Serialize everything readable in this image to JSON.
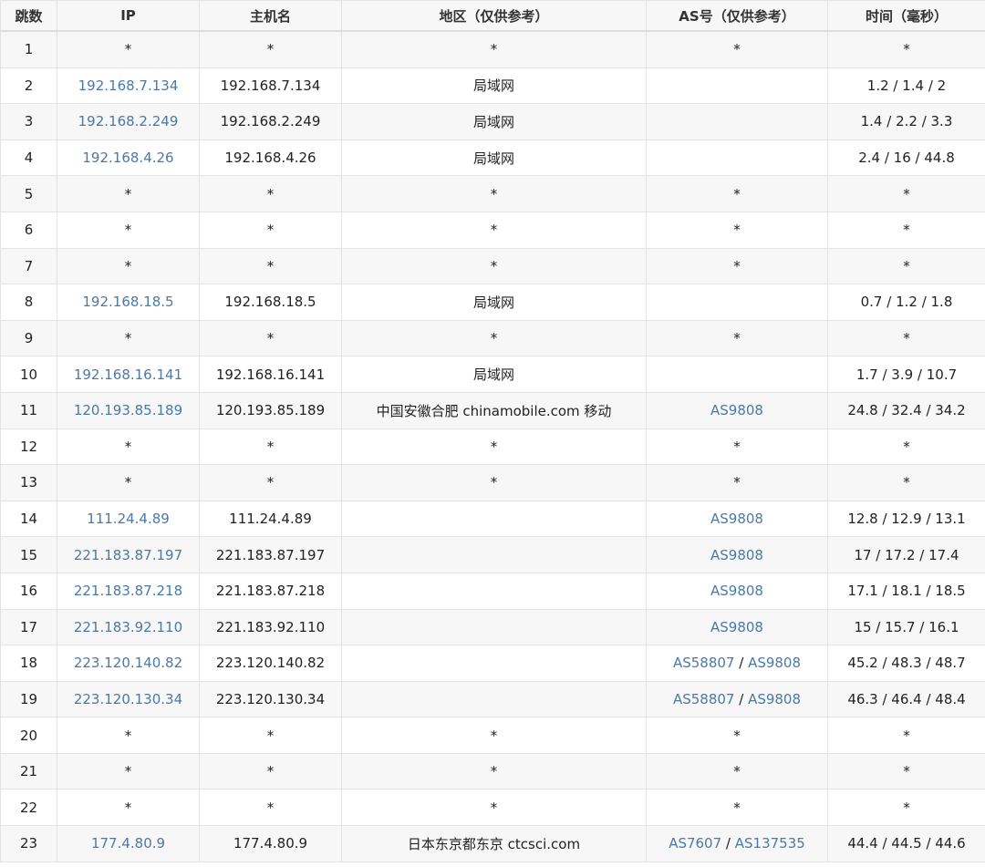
{
  "colors": {
    "link": "#4a79a8",
    "text": "#222222",
    "row_alt": "#f7f7f7",
    "border": "#e3e3e3"
  },
  "table": {
    "columns": [
      "跳数",
      "IP",
      "主机名",
      "地区（仅供参考）",
      "AS号（仅供参考）",
      "时间（毫秒）"
    ],
    "rows": [
      {
        "hop": "1",
        "ip": "*",
        "ip_link": false,
        "host": "*",
        "region": "*",
        "as": [
          "*"
        ],
        "as_link": false,
        "time": "*"
      },
      {
        "hop": "2",
        "ip": "192.168.7.134",
        "ip_link": true,
        "host": "192.168.7.134",
        "region": "局域网",
        "as": [],
        "as_link": false,
        "time": "1.2 / 1.4 / 2"
      },
      {
        "hop": "3",
        "ip": "192.168.2.249",
        "ip_link": true,
        "host": "192.168.2.249",
        "region": "局域网",
        "as": [],
        "as_link": false,
        "time": "1.4 / 2.2 / 3.3"
      },
      {
        "hop": "4",
        "ip": "192.168.4.26",
        "ip_link": true,
        "host": "192.168.4.26",
        "region": "局域网",
        "as": [],
        "as_link": false,
        "time": "2.4 / 16 / 44.8"
      },
      {
        "hop": "5",
        "ip": "*",
        "ip_link": false,
        "host": "*",
        "region": "*",
        "as": [
          "*"
        ],
        "as_link": false,
        "time": "*"
      },
      {
        "hop": "6",
        "ip": "*",
        "ip_link": false,
        "host": "*",
        "region": "*",
        "as": [
          "*"
        ],
        "as_link": false,
        "time": "*"
      },
      {
        "hop": "7",
        "ip": "*",
        "ip_link": false,
        "host": "*",
        "region": "*",
        "as": [
          "*"
        ],
        "as_link": false,
        "time": "*"
      },
      {
        "hop": "8",
        "ip": "192.168.18.5",
        "ip_link": true,
        "host": "192.168.18.5",
        "region": "局域网",
        "as": [],
        "as_link": false,
        "time": "0.7 / 1.2 / 1.8"
      },
      {
        "hop": "9",
        "ip": "*",
        "ip_link": false,
        "host": "*",
        "region": "*",
        "as": [
          "*"
        ],
        "as_link": false,
        "time": "*"
      },
      {
        "hop": "10",
        "ip": "192.168.16.141",
        "ip_link": true,
        "host": "192.168.16.141",
        "region": "局域网",
        "as": [],
        "as_link": false,
        "time": "1.7 / 3.9 / 10.7"
      },
      {
        "hop": "11",
        "ip": "120.193.85.189",
        "ip_link": true,
        "host": "120.193.85.189",
        "region": "中国安徽合肥 chinamobile.com 移动",
        "as": [
          "AS9808"
        ],
        "as_link": true,
        "time": "24.8 / 32.4 / 34.2"
      },
      {
        "hop": "12",
        "ip": "*",
        "ip_link": false,
        "host": "*",
        "region": "*",
        "as": [
          "*"
        ],
        "as_link": false,
        "time": "*"
      },
      {
        "hop": "13",
        "ip": "*",
        "ip_link": false,
        "host": "*",
        "region": "*",
        "as": [
          "*"
        ],
        "as_link": false,
        "time": "*"
      },
      {
        "hop": "14",
        "ip": "111.24.4.89",
        "ip_link": true,
        "host": "111.24.4.89",
        "region": "",
        "as": [
          "AS9808"
        ],
        "as_link": true,
        "time": "12.8 / 12.9 / 13.1"
      },
      {
        "hop": "15",
        "ip": "221.183.87.197",
        "ip_link": true,
        "host": "221.183.87.197",
        "region": "",
        "as": [
          "AS9808"
        ],
        "as_link": true,
        "time": "17 / 17.2 / 17.4"
      },
      {
        "hop": "16",
        "ip": "221.183.87.218",
        "ip_link": true,
        "host": "221.183.87.218",
        "region": "",
        "as": [
          "AS9808"
        ],
        "as_link": true,
        "time": "17.1 / 18.1 / 18.5"
      },
      {
        "hop": "17",
        "ip": "221.183.92.110",
        "ip_link": true,
        "host": "221.183.92.110",
        "region": "",
        "as": [
          "AS9808"
        ],
        "as_link": true,
        "time": "15 / 15.7 / 16.1"
      },
      {
        "hop": "18",
        "ip": "223.120.140.82",
        "ip_link": true,
        "host": "223.120.140.82",
        "region": "",
        "as": [
          "AS58807",
          "AS9808"
        ],
        "as_link": true,
        "time": "45.2 / 48.3 / 48.7"
      },
      {
        "hop": "19",
        "ip": "223.120.130.34",
        "ip_link": true,
        "host": "223.120.130.34",
        "region": "",
        "as": [
          "AS58807",
          "AS9808"
        ],
        "as_link": true,
        "time": "46.3 / 46.4 / 48.4"
      },
      {
        "hop": "20",
        "ip": "*",
        "ip_link": false,
        "host": "*",
        "region": "*",
        "as": [
          "*"
        ],
        "as_link": false,
        "time": "*"
      },
      {
        "hop": "21",
        "ip": "*",
        "ip_link": false,
        "host": "*",
        "region": "*",
        "as": [
          "*"
        ],
        "as_link": false,
        "time": "*"
      },
      {
        "hop": "22",
        "ip": "*",
        "ip_link": false,
        "host": "*",
        "region": "*",
        "as": [
          "*"
        ],
        "as_link": false,
        "time": "*"
      },
      {
        "hop": "23",
        "ip": "177.4.80.9",
        "ip_link": true,
        "host": "177.4.80.9",
        "region": "日本东京都东京 ctcsci.com",
        "as": [
          "AS7607",
          "AS137535"
        ],
        "as_link": true,
        "time": "44.4 / 44.5 / 44.6"
      }
    ]
  }
}
